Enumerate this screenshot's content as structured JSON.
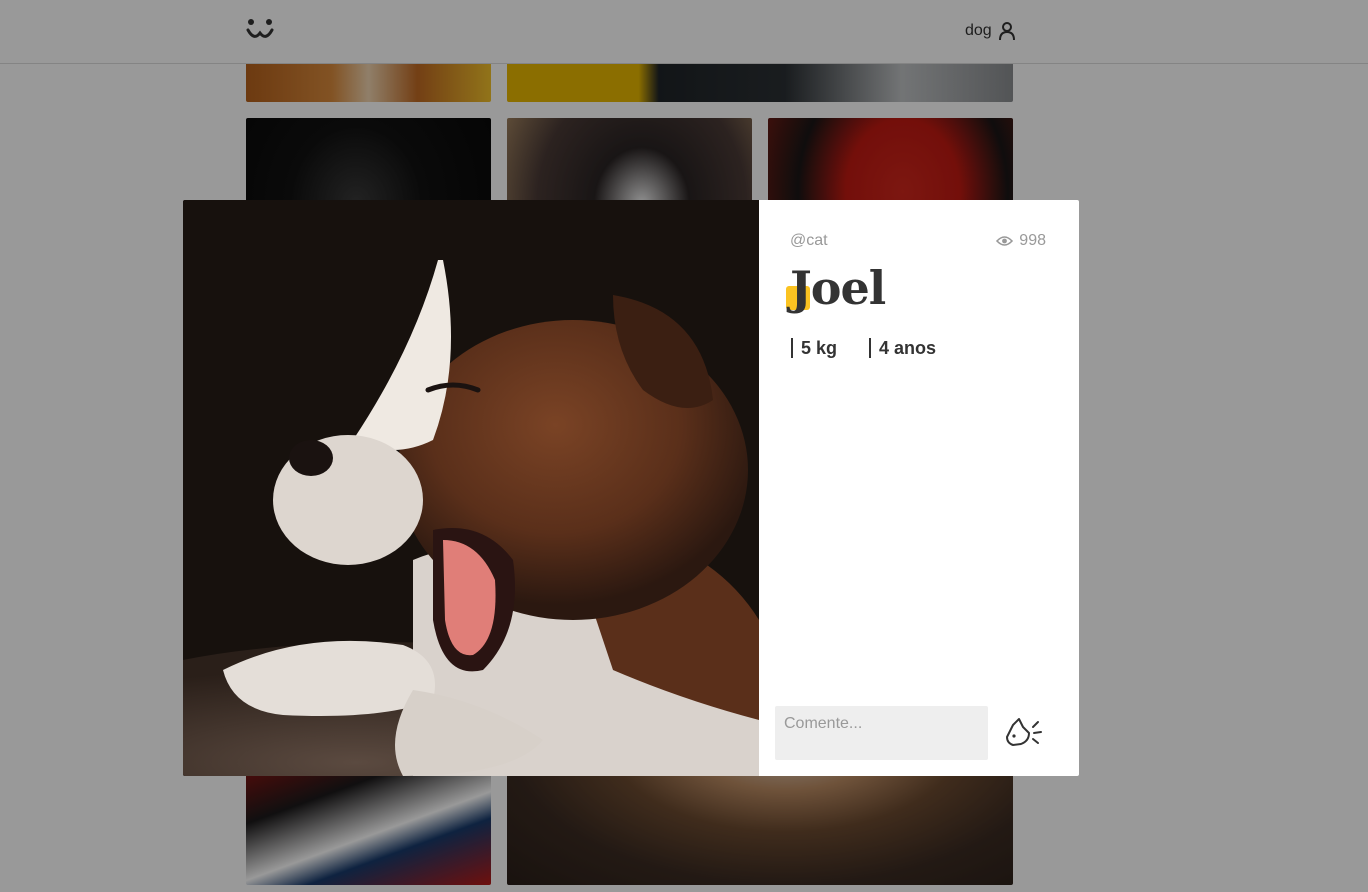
{
  "header": {
    "logo_icon": "dog-face-icon",
    "login_label": "dog",
    "user_icon": "user-icon"
  },
  "modal": {
    "photo": {
      "description_icon": "yawning-puppy-photo"
    },
    "author": "@cat",
    "views": "998",
    "views_icon": "eye-icon",
    "title": "Joel",
    "attributes": {
      "weight": "5 kg",
      "age": "4 anos"
    },
    "comment": {
      "placeholder": "Comente...",
      "value": "",
      "send_icon": "dog-bark-send-icon"
    }
  },
  "colors": {
    "accent": "#fbc015",
    "text": "#333333",
    "muted": "#999999",
    "overlay": "rgba(0,0,0,0.4)"
  }
}
